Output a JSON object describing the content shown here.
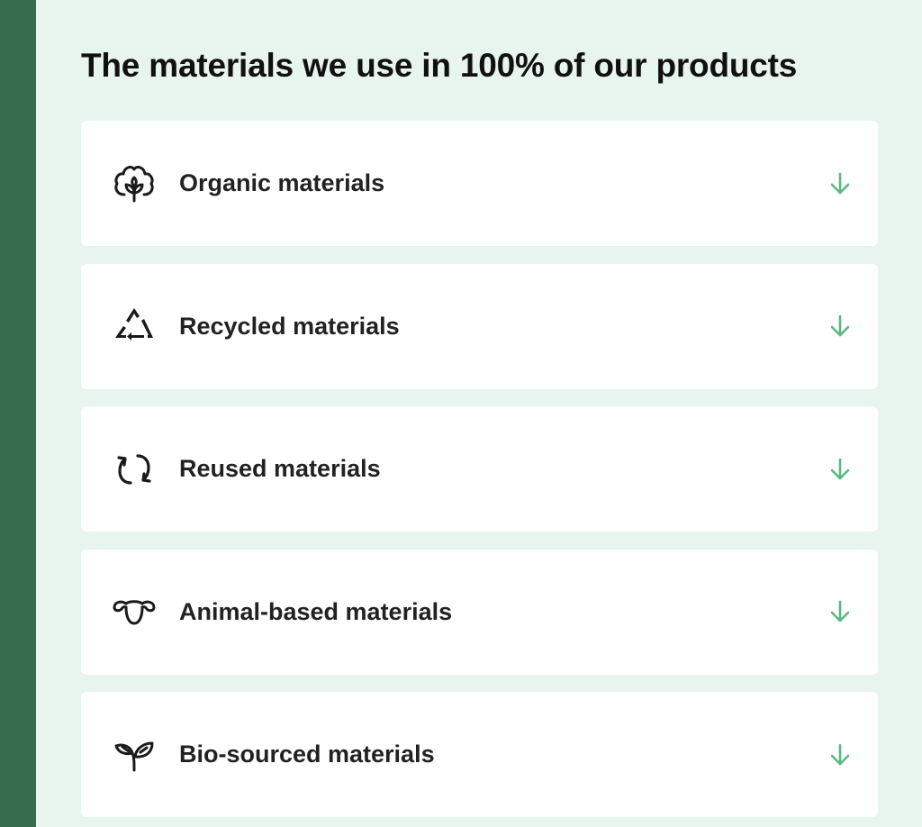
{
  "section": {
    "title": "The materials we use in 100% of our products"
  },
  "colors": {
    "sidebar": "#386c4e",
    "background": "#e8f4ee",
    "card": "#ffffff",
    "accent_arrow": "#5bb883",
    "text": "#222222"
  },
  "accordion": {
    "items": [
      {
        "label": "Organic materials",
        "icon": "cotton-flower-icon"
      },
      {
        "label": "Recycled materials",
        "icon": "recycle-triangle-icon"
      },
      {
        "label": "Reused materials",
        "icon": "reuse-arrows-icon"
      },
      {
        "label": "Animal-based materials",
        "icon": "sheep-head-icon"
      },
      {
        "label": "Bio-sourced materials",
        "icon": "sprout-leaves-icon"
      }
    ],
    "expand_icon": "arrow-down-icon"
  }
}
